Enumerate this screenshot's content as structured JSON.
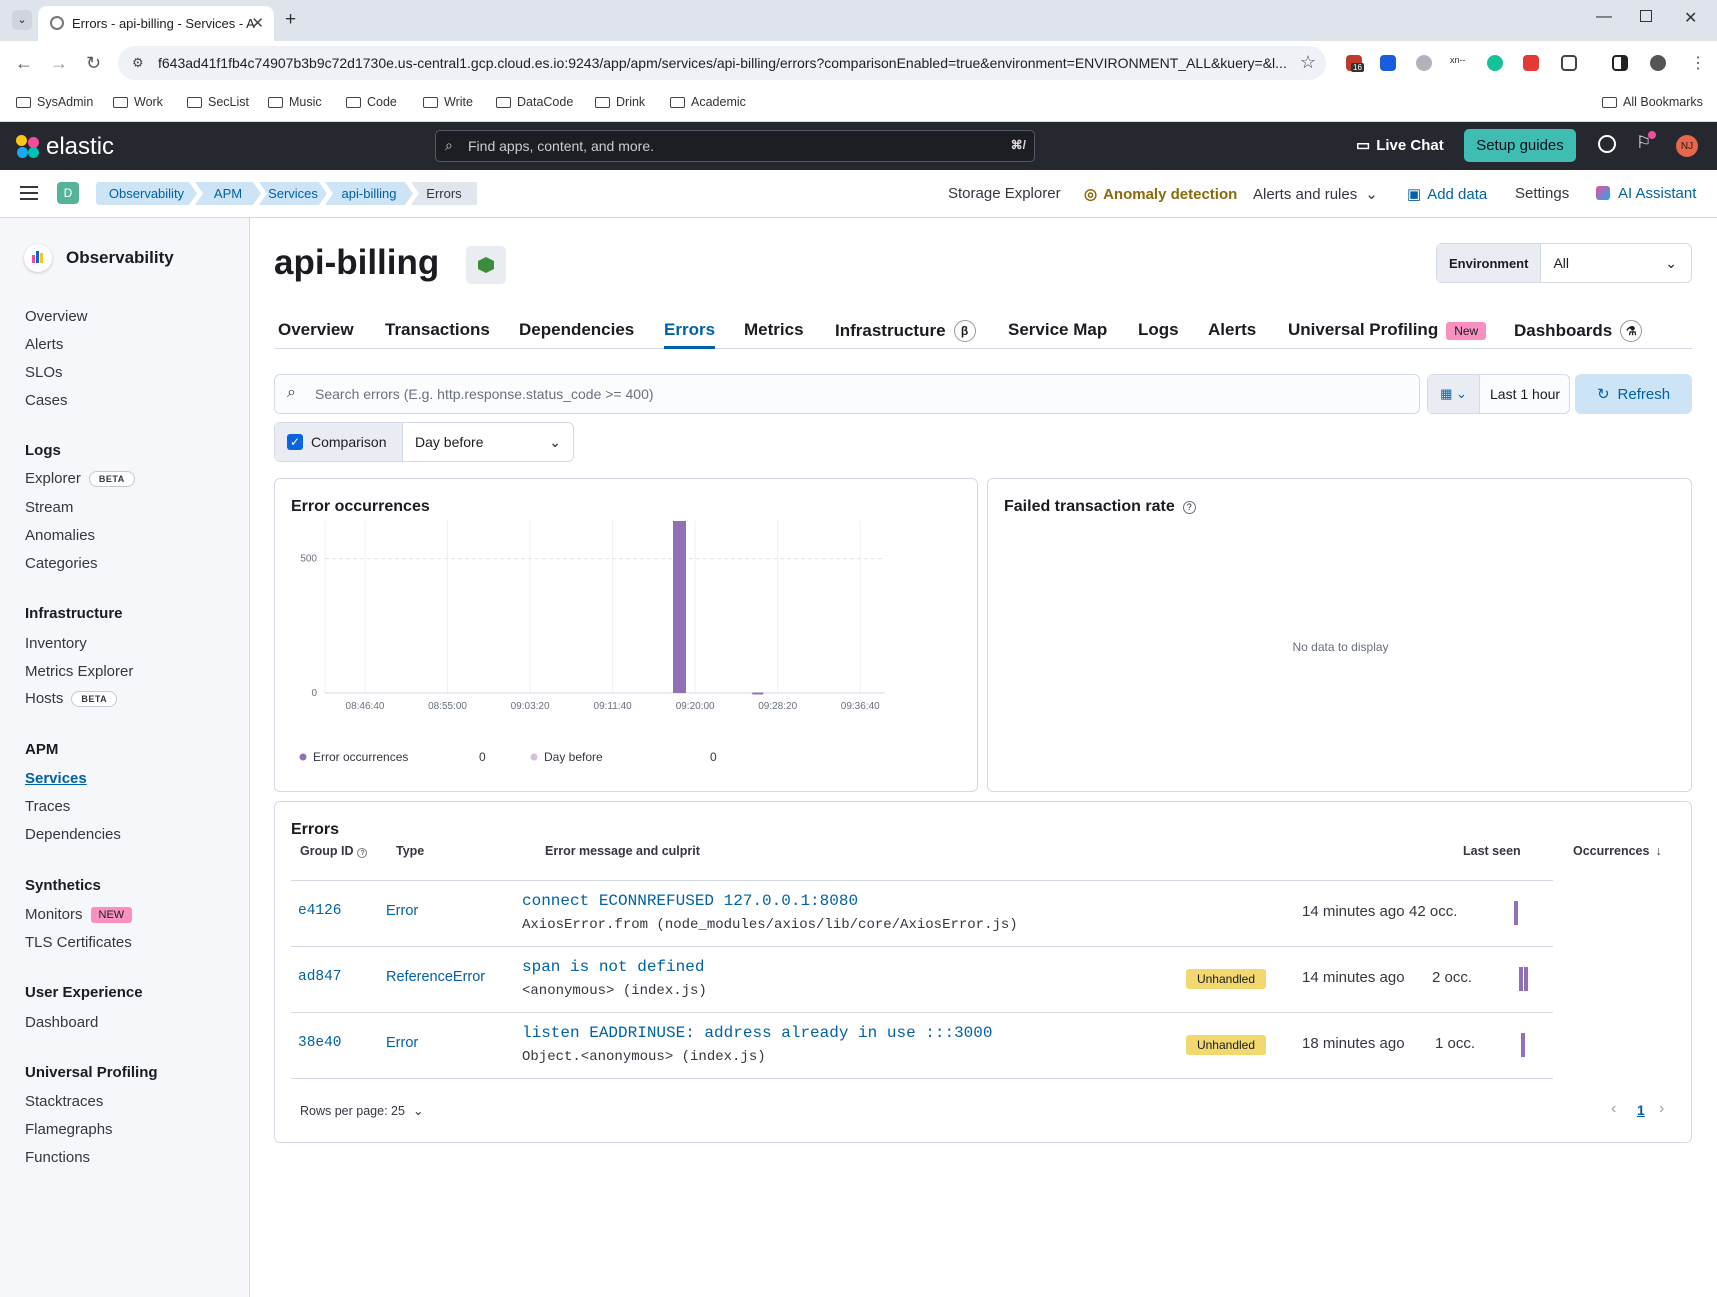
{
  "browser": {
    "tab_title": "Errors - api-billing - Services - A",
    "url": "f643ad41f1fb4c74907b3b9c72d1730e.us-central1.gcp.cloud.es.io:9243/app/apm/services/api-billing/errors?comparisonEnabled=true&environment=ENVIRONMENT_ALL&kuery=&l...",
    "bookmarks": [
      "SysAdmin",
      "Work",
      "SecList",
      "Music",
      "Code",
      "Write",
      "DataCode",
      "Drink",
      "Academic"
    ],
    "all_bookmarks": "All Bookmarks",
    "ext_badge": "16"
  },
  "header": {
    "logo_text": "elastic",
    "search_placeholder": "Find apps, content, and more.",
    "search_shortcut": "⌘/",
    "live_chat": "Live Chat",
    "setup_guides": "Setup guides",
    "avatar_initials": "NJ"
  },
  "subheader": {
    "space": "D",
    "breadcrumbs": [
      "Observability",
      "APM",
      "Services",
      "api-billing",
      "Errors"
    ],
    "links": {
      "storage": "Storage Explorer",
      "anomaly": "Anomaly detection",
      "alerts": "Alerts and rules",
      "add_data": "Add data",
      "settings": "Settings",
      "ai": "AI Assistant"
    }
  },
  "sidebar": {
    "title": "Observability",
    "top_items": [
      "Overview",
      "Alerts",
      "SLOs",
      "Cases"
    ],
    "groups": [
      {
        "name": "Logs",
        "items": [
          "Explorer",
          "Stream",
          "Anomalies",
          "Categories"
        ]
      },
      {
        "name": "Infrastructure",
        "items": [
          "Inventory",
          "Metrics Explorer",
          "Hosts"
        ]
      },
      {
        "name": "APM",
        "items": [
          "Services",
          "Traces",
          "Dependencies"
        ]
      },
      {
        "name": "Synthetics",
        "items": [
          "Monitors",
          "TLS Certificates"
        ]
      },
      {
        "name": "User Experience",
        "items": [
          "Dashboard"
        ]
      },
      {
        "name": "Universal Profiling",
        "items": [
          "Stacktraces",
          "Flamegraphs",
          "Functions"
        ]
      }
    ],
    "badges": {
      "beta": "BETA",
      "new": "NEW"
    }
  },
  "page": {
    "title": "api-billing",
    "environment_label": "Environment",
    "environment_value": "All",
    "tabs": [
      "Overview",
      "Transactions",
      "Dependencies",
      "Errors",
      "Metrics",
      "Infrastructure",
      "Service Map",
      "Logs",
      "Alerts",
      "Universal Profiling",
      "Dashboards"
    ],
    "active_tab": "Errors",
    "beta_symbol": "β",
    "new_badge": "New",
    "search_placeholder": "Search errors (E.g. http.response.status_code >= 400)",
    "time_range": "Last 1 hour",
    "refresh": "Refresh",
    "comparison_label": "Comparison",
    "comparison_value": "Day before"
  },
  "chart_data": {
    "type": "bar",
    "title": "Error occurrences",
    "x": [
      "08:46:40",
      "08:55:00",
      "09:03:20",
      "09:11:40",
      "09:20:00",
      "09:28:20",
      "09:36:40"
    ],
    "y_ticks": [
      "0",
      "500"
    ],
    "ylim": [
      0,
      640
    ],
    "bars": [
      {
        "time_offset_min": 31.7,
        "value": 640
      },
      {
        "time_offset_min": 39.7,
        "value": 2
      }
    ],
    "legend": [
      {
        "name": "Error occurrences",
        "value": "0",
        "color": "#9170b8"
      },
      {
        "name": "Day before",
        "value": "0",
        "color": "#d6bfdd"
      }
    ]
  },
  "failed_rate": {
    "title": "Failed transaction rate",
    "empty": "No data to display"
  },
  "errors_table": {
    "title": "Errors",
    "columns": [
      "Group ID",
      "Type",
      "Error message and culprit",
      "Last seen",
      "Occurrences"
    ],
    "rows": [
      {
        "group": "e4126",
        "type": "Error",
        "message": "connect ECONNREFUSED 127.0.0.1:8080",
        "culprit": "AxiosError.from (node_modules/axios/lib/core/AxiosError.js)",
        "unhandled": "",
        "last_seen": "14 minutes ago",
        "occurrences": "42 occ."
      },
      {
        "group": "ad847",
        "type": "ReferenceError",
        "message": "span is not defined",
        "culprit": "<anonymous> (index.js)",
        "unhandled": "Unhandled",
        "last_seen": "14 minutes ago",
        "occurrences": "2 occ."
      },
      {
        "group": "38e40",
        "type": "Error",
        "message": "listen EADDRINUSE: address already in use :::3000",
        "culprit": "Object.<anonymous> (index.js)",
        "unhandled": "Unhandled",
        "last_seen": "18 minutes ago",
        "occurrences": "1 occ."
      }
    ],
    "rows_per_page": "Rows per page: 25",
    "page": "1"
  },
  "colors": {
    "accent": "#0061a6",
    "chart": "#9170b8",
    "teal": "#40bdb3",
    "header": "#25282f"
  }
}
